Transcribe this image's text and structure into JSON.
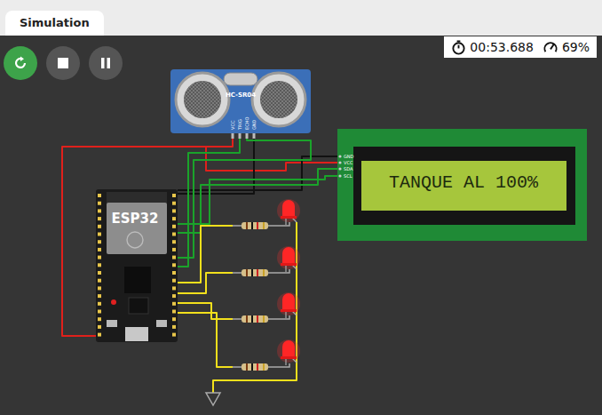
{
  "tabs": [
    {
      "label": "Simulation",
      "selected": true
    }
  ],
  "controls": [
    {
      "kind": "restart"
    },
    {
      "kind": "stop"
    },
    {
      "kind": "pause"
    }
  ],
  "status": {
    "time": "00:53.688",
    "speed": "69%"
  },
  "sensor": {
    "name": "HC-SR04",
    "pins": [
      "VCC",
      "TRIG",
      "ECHO",
      "GND"
    ]
  },
  "board": {
    "name": "ESP32"
  },
  "lcd": {
    "text": "TANQUE AL 100%",
    "pins": [
      "GND",
      "VCC",
      "SDA",
      "SCL"
    ]
  },
  "leds": [
    {
      "on": true
    },
    {
      "on": true
    },
    {
      "on": true
    },
    {
      "on": true
    }
  ]
}
